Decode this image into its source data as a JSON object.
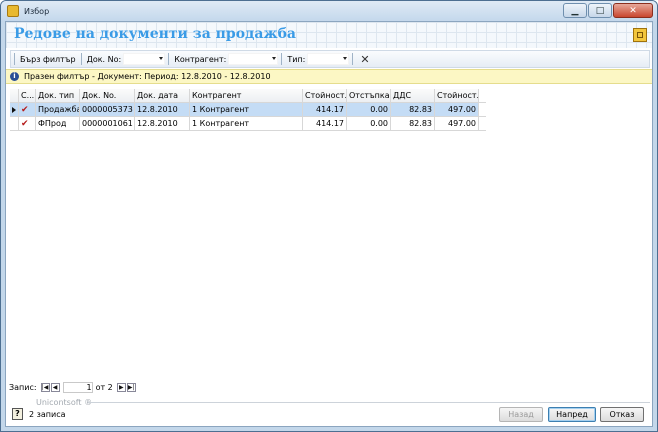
{
  "window": {
    "title": "Избор",
    "buttons": {
      "minimize": "▁",
      "maximize": "□",
      "close": "✕"
    }
  },
  "page": {
    "title": "Редове на документи за продажба"
  },
  "filter_bar": {
    "quick_filter": "Бърз филтър",
    "doc_no_label": "Док. No:",
    "contractor_label": "Контрагент:",
    "type_label": "Тип:",
    "clear_icon": "✕"
  },
  "info_bar": {
    "text": "Празен филтър - Документ: Период: 12.8.2010 - 12.8.2010"
  },
  "table": {
    "columns": [
      "С...",
      "Док. тип",
      "Док. No.",
      "Док. дата",
      "Контрагент",
      "Стойност...",
      "Отстъпка",
      "ДДС",
      "Стойност..."
    ],
    "rows": [
      {
        "doc_type": "Продажба",
        "doc_no": "0000005373",
        "doc_date": "12.8.2010",
        "contractor": "1 Контрагент",
        "value": "414.17",
        "discount": "0.00",
        "vat": "82.83",
        "total": "497.00",
        "selected": true
      },
      {
        "doc_type": "ФПрод",
        "doc_no": "0000001061",
        "doc_date": "12.8.2010",
        "contractor": "1 Контрагент",
        "value": "414.17",
        "discount": "0.00",
        "vat": "82.83",
        "total": "497.00",
        "selected": false
      }
    ]
  },
  "navigator": {
    "label": "Запис:",
    "current": "1",
    "of_text": "от 2"
  },
  "watermark": "Unicontsoft ®",
  "footer": {
    "count_text": "2 записа",
    "back_button": "Назад",
    "next_button": "Напред",
    "cancel_button": "Отказ"
  },
  "colors": {
    "accent": "#3a9be6",
    "selection": "#c4dcf5",
    "info_bg": "#fcf7c4"
  }
}
